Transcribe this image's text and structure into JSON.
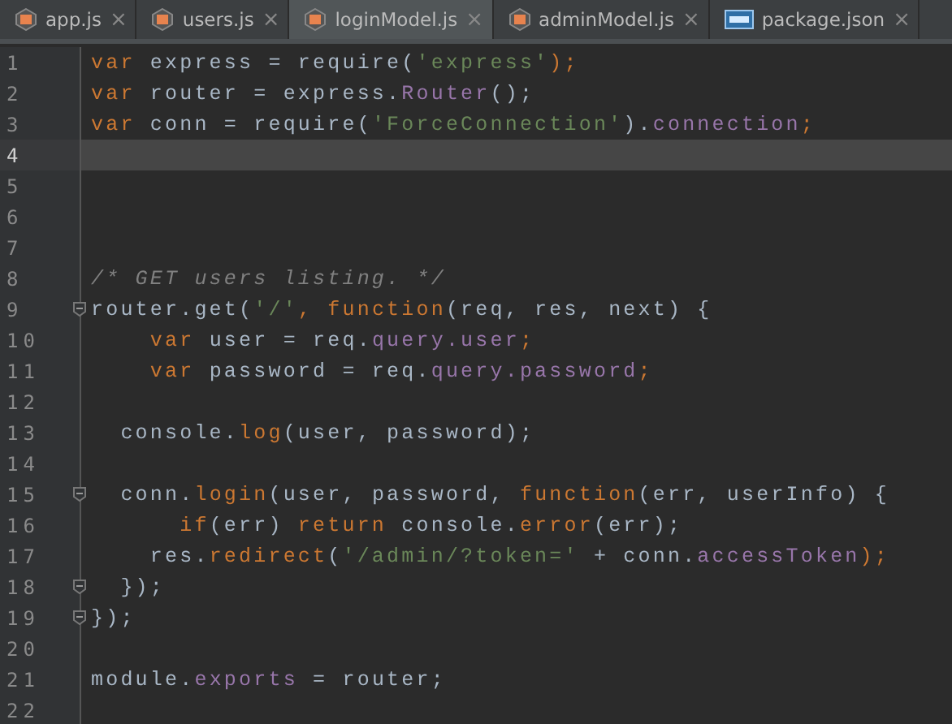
{
  "tabs": [
    {
      "label": "app.js",
      "kind": "js",
      "selected": false
    },
    {
      "label": "users.js",
      "kind": "js",
      "selected": false
    },
    {
      "label": "loginModel.js",
      "kind": "js",
      "selected": true
    },
    {
      "label": "adminModel.js",
      "kind": "js",
      "selected": false
    },
    {
      "label": "package.json",
      "kind": "json",
      "selected": false
    }
  ],
  "tab_close": "×",
  "lines": [
    {
      "number": "1",
      "current": false,
      "fold": false,
      "tokens": [
        {
          "text": "var ",
          "kind": "keyword"
        },
        {
          "text": "express = require(",
          "kind": "plain"
        },
        {
          "text": "'express'",
          "kind": "string"
        },
        {
          "text": ");",
          "kind": "keyword"
        }
      ]
    },
    {
      "number": "2",
      "current": false,
      "fold": false,
      "tokens": [
        {
          "text": "var ",
          "kind": "keyword"
        },
        {
          "text": "router = express.",
          "kind": "plain"
        },
        {
          "text": "Router",
          "kind": "property"
        },
        {
          "text": "();",
          "kind": "plain"
        }
      ]
    },
    {
      "number": "3",
      "current": false,
      "fold": false,
      "tokens": [
        {
          "text": "var ",
          "kind": "keyword"
        },
        {
          "text": "conn = require(",
          "kind": "plain"
        },
        {
          "text": "'ForceConnection'",
          "kind": "string"
        },
        {
          "text": ").",
          "kind": "plain"
        },
        {
          "text": "connection",
          "kind": "property"
        },
        {
          "text": ";",
          "kind": "keyword"
        }
      ]
    },
    {
      "number": "4",
      "current": true,
      "fold": false
    },
    {
      "number": "5",
      "current": false,
      "fold": false
    },
    {
      "number": "6",
      "current": false,
      "fold": false
    },
    {
      "number": "7",
      "current": false,
      "fold": false
    },
    {
      "number": "8",
      "current": false,
      "fold": false,
      "tokens": [
        {
          "text": "/* GET users listing. */",
          "kind": "comment"
        }
      ]
    },
    {
      "number": "9",
      "current": false,
      "fold": true,
      "tokens": [
        {
          "text": "router.get(",
          "kind": "plain"
        },
        {
          "text": "'/'",
          "kind": "string"
        },
        {
          "text": ", ",
          "kind": "keyword"
        },
        {
          "text": "function",
          "kind": "keyword"
        },
        {
          "text": "(req, res, next) {",
          "kind": "plain"
        }
      ]
    },
    {
      "number": "10",
      "current": false,
      "fold": false,
      "tokens": [
        {
          "text": "    var ",
          "kind": "keyword"
        },
        {
          "text": "user = req.",
          "kind": "plain"
        },
        {
          "text": "query",
          "kind": "property"
        },
        {
          "text": ".user",
          "kind": "property"
        },
        {
          "text": ";",
          "kind": "keyword"
        }
      ]
    },
    {
      "number": "11",
      "current": false,
      "fold": false,
      "tokens": [
        {
          "text": "    var ",
          "kind": "keyword"
        },
        {
          "text": "password = req.",
          "kind": "plain"
        },
        {
          "text": "query",
          "kind": "property"
        },
        {
          "text": ".password",
          "kind": "property"
        },
        {
          "text": ";",
          "kind": "keyword"
        }
      ]
    },
    {
      "number": "12",
      "current": false,
      "fold": false
    },
    {
      "number": "13",
      "current": false,
      "fold": false,
      "tokens": [
        {
          "text": "  console.",
          "kind": "plain"
        },
        {
          "text": "log",
          "kind": "keyword"
        },
        {
          "text": "(user, password);",
          "kind": "plain"
        }
      ]
    },
    {
      "number": "14",
      "current": false,
      "fold": false
    },
    {
      "number": "15",
      "current": false,
      "fold": true,
      "tokens": [
        {
          "text": "  conn.",
          "kind": "plain"
        },
        {
          "text": "login",
          "kind": "keyword"
        },
        {
          "text": "(user, password, ",
          "kind": "plain"
        },
        {
          "text": "function",
          "kind": "keyword"
        },
        {
          "text": "(err, userInfo) {",
          "kind": "plain"
        }
      ]
    },
    {
      "number": "16",
      "current": false,
      "fold": false,
      "tokens": [
        {
          "text": "      if",
          "kind": "keyword"
        },
        {
          "text": "(err) ",
          "kind": "plain"
        },
        {
          "text": "return ",
          "kind": "keyword"
        },
        {
          "text": "console.",
          "kind": "plain"
        },
        {
          "text": "error",
          "kind": "keyword"
        },
        {
          "text": "(err);",
          "kind": "plain"
        }
      ]
    },
    {
      "number": "17",
      "current": false,
      "fold": false,
      "tokens": [
        {
          "text": "    res.",
          "kind": "plain"
        },
        {
          "text": "redirect",
          "kind": "keyword"
        },
        {
          "text": "(",
          "kind": "plain"
        },
        {
          "text": "'/admin/?token='",
          "kind": "string"
        },
        {
          "text": " + conn.",
          "kind": "plain"
        },
        {
          "text": "accessToken",
          "kind": "property"
        },
        {
          "text": ");",
          "kind": "keyword"
        }
      ]
    },
    {
      "number": "18",
      "current": false,
      "fold": true,
      "tokens": [
        {
          "text": "  });",
          "kind": "plain"
        }
      ]
    },
    {
      "number": "19",
      "current": false,
      "fold": true,
      "tokens": [
        {
          "text": "});",
          "kind": "plain"
        }
      ]
    },
    {
      "number": "20",
      "current": false,
      "fold": false
    },
    {
      "number": "21",
      "current": false,
      "fold": false,
      "tokens": [
        {
          "text": "module.",
          "kind": "plain"
        },
        {
          "text": "exports",
          "kind": "property"
        },
        {
          "text": " = router;",
          "kind": "plain"
        }
      ]
    },
    {
      "number": "22",
      "current": false,
      "fold": false
    }
  ]
}
